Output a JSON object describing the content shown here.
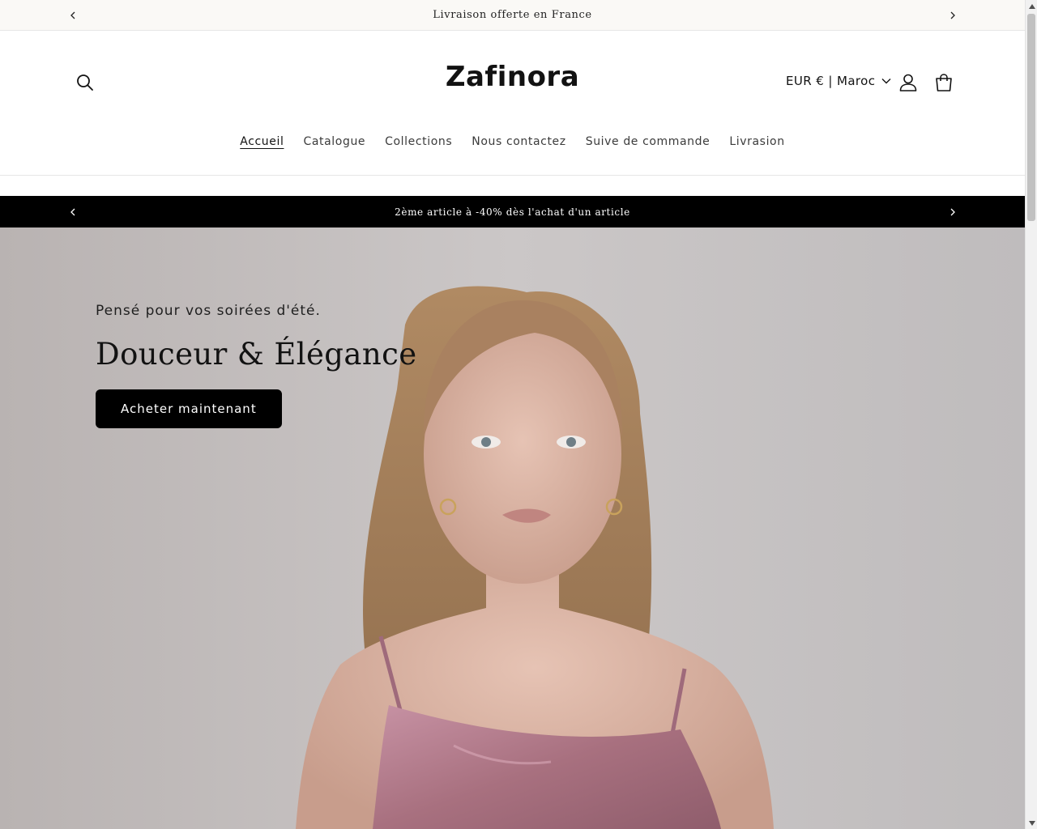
{
  "announcement_top": {
    "message": "Livraison offerte en France"
  },
  "header": {
    "logo": "Zafinora",
    "currency": "EUR € | Maroc"
  },
  "nav": {
    "items": [
      {
        "label": "Accueil",
        "active": true
      },
      {
        "label": "Catalogue"
      },
      {
        "label": "Collections"
      },
      {
        "label": "Nous contactez"
      },
      {
        "label": "Suive de commande"
      },
      {
        "label": "Livrasion"
      }
    ]
  },
  "announcement_dark": {
    "message": "2ème article à -40% dès l'achat d'un article"
  },
  "hero": {
    "subtitle": "Pensé pour vos soirées d'été.",
    "title": "Douceur & Élégance",
    "cta": "Acheter maintenant"
  },
  "colors": {
    "dark_bar": "#000000",
    "top_bar": "#faf9f6",
    "hero_background": "#c9c4c4",
    "dress": "#b97f92",
    "button": "#000000"
  },
  "icons": [
    "chevron-left-icon",
    "chevron-right-icon",
    "search-icon",
    "chevron-down-icon",
    "account-icon",
    "cart-icon"
  ]
}
